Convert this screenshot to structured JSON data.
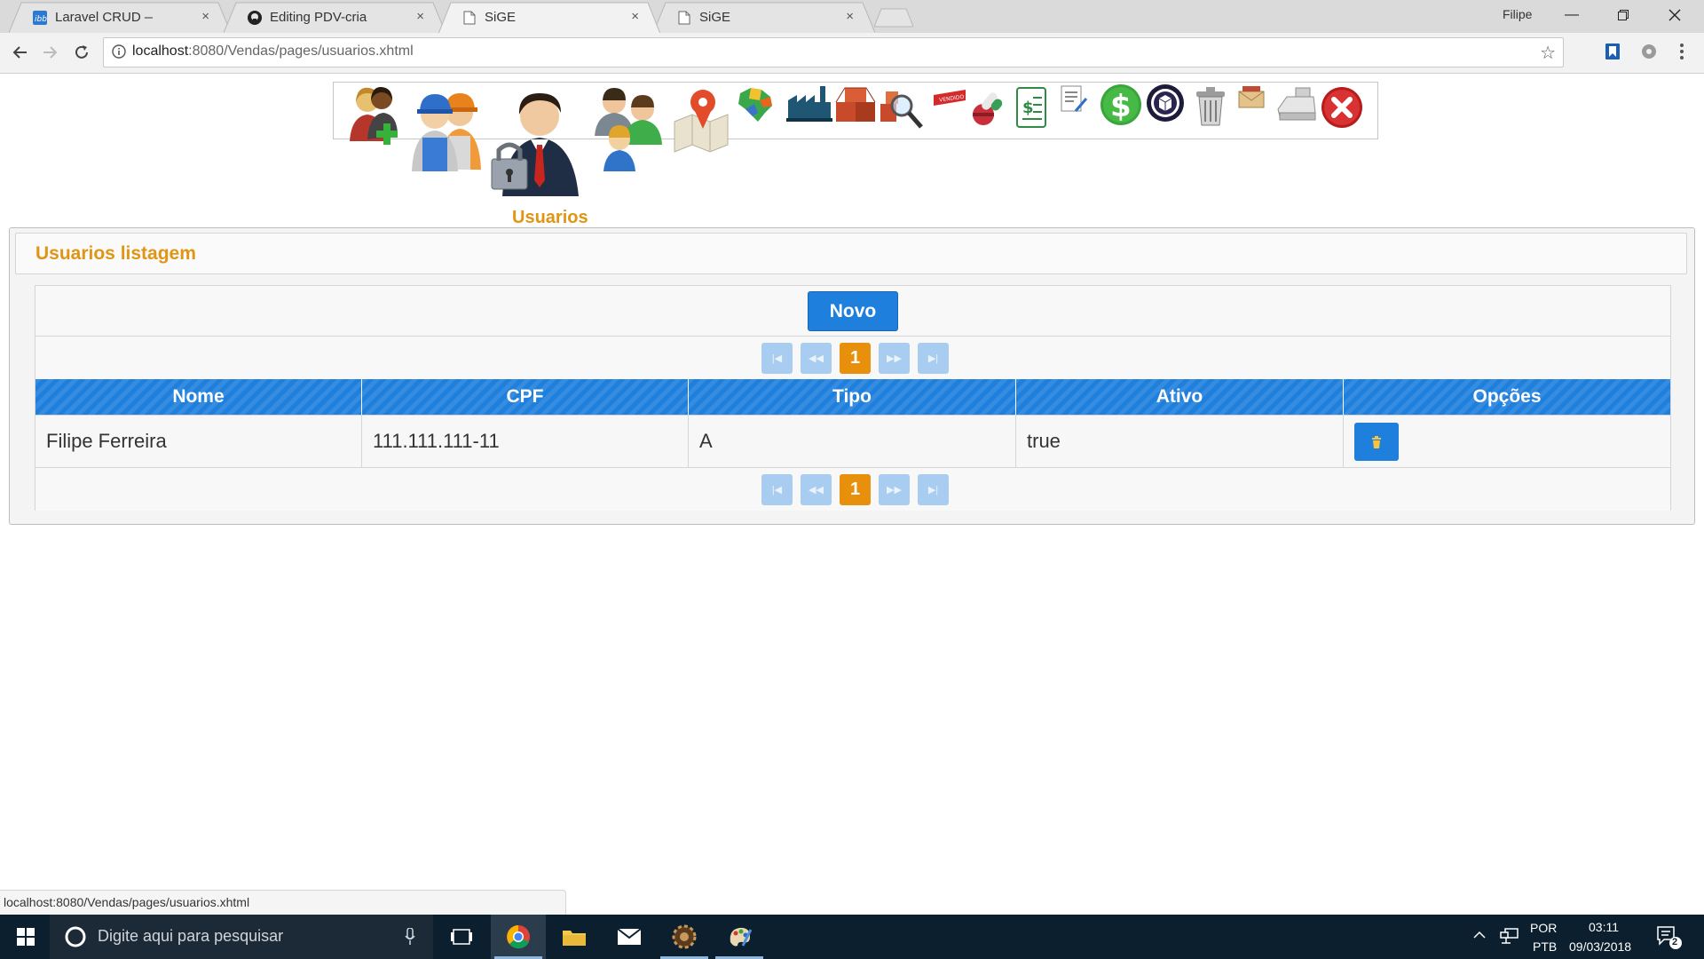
{
  "browser": {
    "tabs": [
      {
        "title": "Laravel CRUD — imgbb.c",
        "favicon": "imgbb-icon",
        "active": false
      },
      {
        "title": "Editing PDV-criado-com",
        "favicon": "github-icon",
        "active": false
      },
      {
        "title": "SiGE",
        "favicon": "page-icon",
        "active": true
      },
      {
        "title": "SiGE",
        "favicon": "page-icon",
        "active": false
      }
    ],
    "close_glyph": "×",
    "profile_name": "Filipe",
    "url_host": "localhost",
    "url_rest": ":8080/Vendas/pages/usuarios.xhtml"
  },
  "menu": {
    "active_label": "Usuarios",
    "items": [
      "clientes-icon",
      "funcionarios-icon",
      "usuarios-icon",
      "fornecedores-icon",
      "mapa-icon",
      "estados-icon",
      "fabrica-icon",
      "produtos-icon",
      "pesquisa-icon",
      "vendido-icon",
      "farmacia-icon",
      "relatorio-icon",
      "documento-icon",
      "dinheiro-icon",
      "caixa-icon",
      "lixeira-icon",
      "caixa-postal-icon",
      "caixa-registradora-icon",
      "sair-icon"
    ],
    "colors": {
      "accent": "#e09514"
    }
  },
  "panel": {
    "title": "Usuarios listagem",
    "new_button": "Novo",
    "pager": {
      "current_page": "1"
    },
    "columns": [
      "Nome",
      "CPF",
      "Tipo",
      "Ativo",
      "Opções"
    ],
    "rows": [
      {
        "nome": "Filipe Ferreira",
        "cpf": "111.111.111-11",
        "tipo": "A",
        "ativo": "true"
      }
    ],
    "colors": {
      "header": "#1e7fdc",
      "current_page": "#e8900c"
    }
  },
  "status_url": "localhost:8080/Vendas/pages/usuarios.xhtml",
  "taskbar": {
    "search_placeholder": "Digite aqui para pesquisar",
    "lang_top": "POR",
    "lang_bottom": "PTB",
    "time": "03:11",
    "date": "09/03/2018",
    "notifications": "2"
  }
}
